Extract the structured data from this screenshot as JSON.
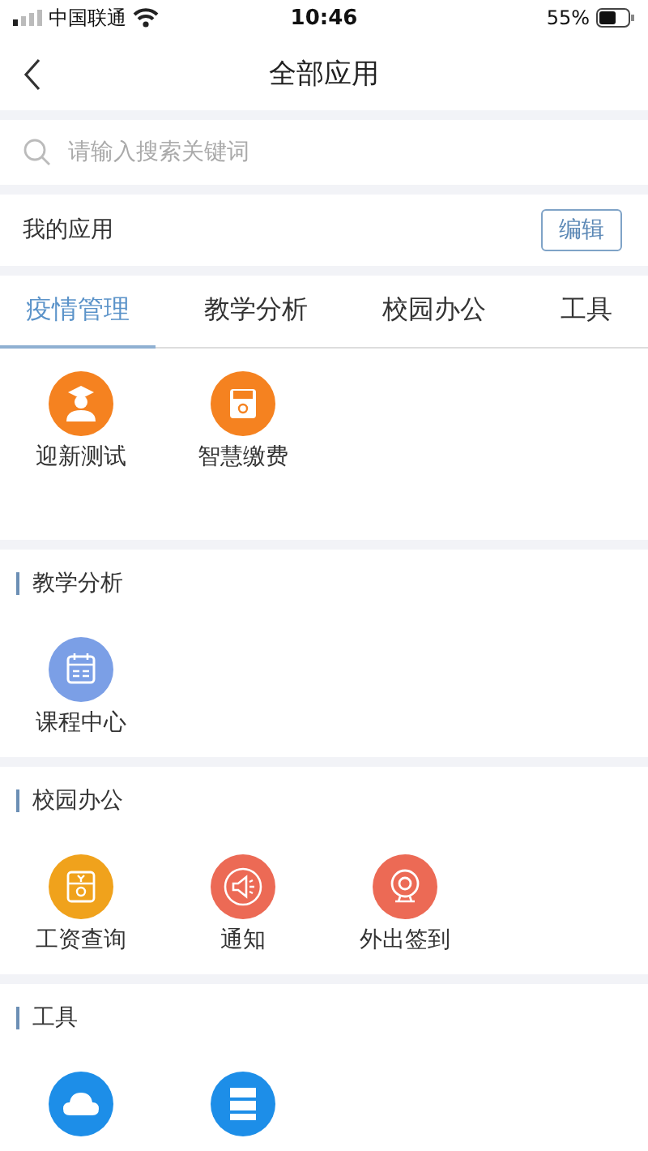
{
  "status_bar": {
    "carrier": "中国联通",
    "time": "10:46",
    "battery": "55%"
  },
  "header": {
    "title": "全部应用"
  },
  "search": {
    "placeholder": "请输入搜索关键词"
  },
  "my_apps": {
    "label": "我的应用",
    "edit_button": "编辑"
  },
  "tabs": [
    {
      "label": "疫情管理",
      "selected": true
    },
    {
      "label": "教学分析",
      "selected": false
    },
    {
      "label": "校园办公",
      "selected": false
    },
    {
      "label": "工具",
      "selected": false
    }
  ],
  "sections": [
    {
      "apps": [
        {
          "label": "迎新测试",
          "kind": "graduate",
          "color": "#f58220"
        },
        {
          "label": "智慧缴费",
          "kind": "shop",
          "color": "#f58220"
        }
      ]
    },
    {
      "title": "教学分析",
      "apps": [
        {
          "label": "课程中心",
          "kind": "calendar",
          "color": "#7b9fe6"
        }
      ]
    },
    {
      "title": "校园办公",
      "apps": [
        {
          "label": "工资查询",
          "kind": "wallet",
          "color": "#f0a21c"
        },
        {
          "label": "通知",
          "kind": "megaphone",
          "color": "#ec6a55"
        },
        {
          "label": "外出签到",
          "kind": "camera",
          "color": "#ec6a55"
        }
      ]
    },
    {
      "title": "工具",
      "apps": [
        {
          "kind": "cloud",
          "color": "#1d8ee8"
        },
        {
          "kind": "server",
          "color": "#1d8ee8"
        }
      ]
    }
  ]
}
